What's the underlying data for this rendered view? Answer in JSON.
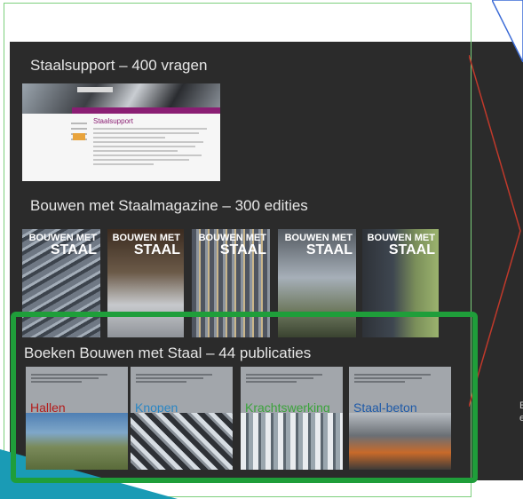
{
  "sections": {
    "support": {
      "title": "Staalsupport – 400 vragen",
      "thumb_title": "Staalsupport"
    },
    "magazine": {
      "title": "Bouwen met Staalmagazine – 300 edities",
      "covers": [
        {
          "line1": "BOUWEN MET",
          "line2": "STAAL"
        },
        {
          "line1": "BOUWEN MET",
          "line2": "STAAL"
        },
        {
          "line1": "BOUWEN MET",
          "line2": "STAAL"
        },
        {
          "line1": "BOUWEN MET",
          "line2": "STAAL"
        },
        {
          "line1": "BOUWEN MET",
          "line2": "STAAL"
        }
      ]
    },
    "books": {
      "title": "Boeken Bouwen met Staal – 44 publicaties",
      "items": [
        {
          "title": "Hallen"
        },
        {
          "title": "Knopen"
        },
        {
          "title": "Krachtswerking"
        },
        {
          "title": "Staal-beton"
        }
      ]
    }
  },
  "right_panel": {
    "line1": "E",
    "line2": "e"
  },
  "colors": {
    "panel_bg": "#2b2b2b",
    "highlight_green": "#1f9e3a",
    "arrow_red": "#c0392b",
    "triangle_blue": "#3b6bd6",
    "teal": "#1a9bb5"
  }
}
